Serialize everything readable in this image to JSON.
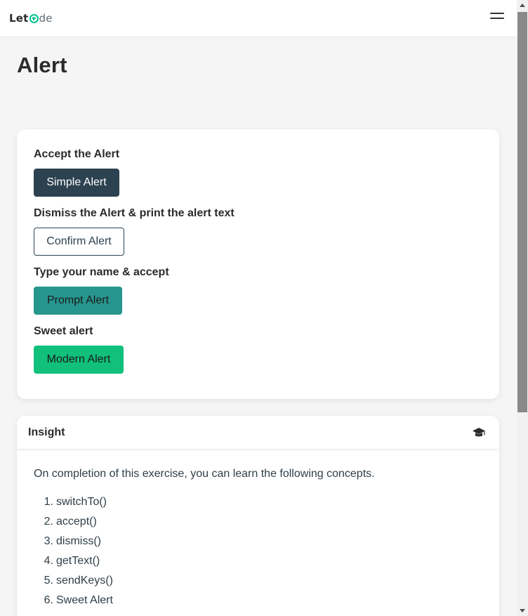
{
  "header": {
    "logo": {
      "prefix": "Let",
      "mark_icon": "code-plus-icon",
      "suffix": "de"
    },
    "menu_icon": "hamburger-menu-icon"
  },
  "page": {
    "title": "Alert"
  },
  "alerts_card": {
    "items": [
      {
        "label": "Accept the Alert",
        "button": "Simple Alert"
      },
      {
        "label": "Dismiss the Alert & print the alert text",
        "button": "Confirm Alert"
      },
      {
        "label": "Type your name & accept",
        "button": "Prompt Alert"
      },
      {
        "label": "Sweet alert",
        "button": "Modern Alert"
      }
    ]
  },
  "insight": {
    "title": "Insight",
    "icon": "graduation-cap-icon",
    "intro": "On completion of this exercise, you can learn the following concepts.",
    "concepts": [
      {
        "num": "1.",
        "text": "switchTo()"
      },
      {
        "num": "2.",
        "text": "accept()"
      },
      {
        "num": "3.",
        "text": "dismiss()"
      },
      {
        "num": "4.",
        "text": "getText()"
      },
      {
        "num": "5.",
        "text": "sendKeys()"
      },
      {
        "num": "6.",
        "text": "Sweet Alert"
      }
    ]
  },
  "colors": {
    "brand_green": "#00c18c",
    "simple_button": "#2c4250",
    "prompt_button": "#27968f",
    "modern_button": "#10c07b"
  }
}
